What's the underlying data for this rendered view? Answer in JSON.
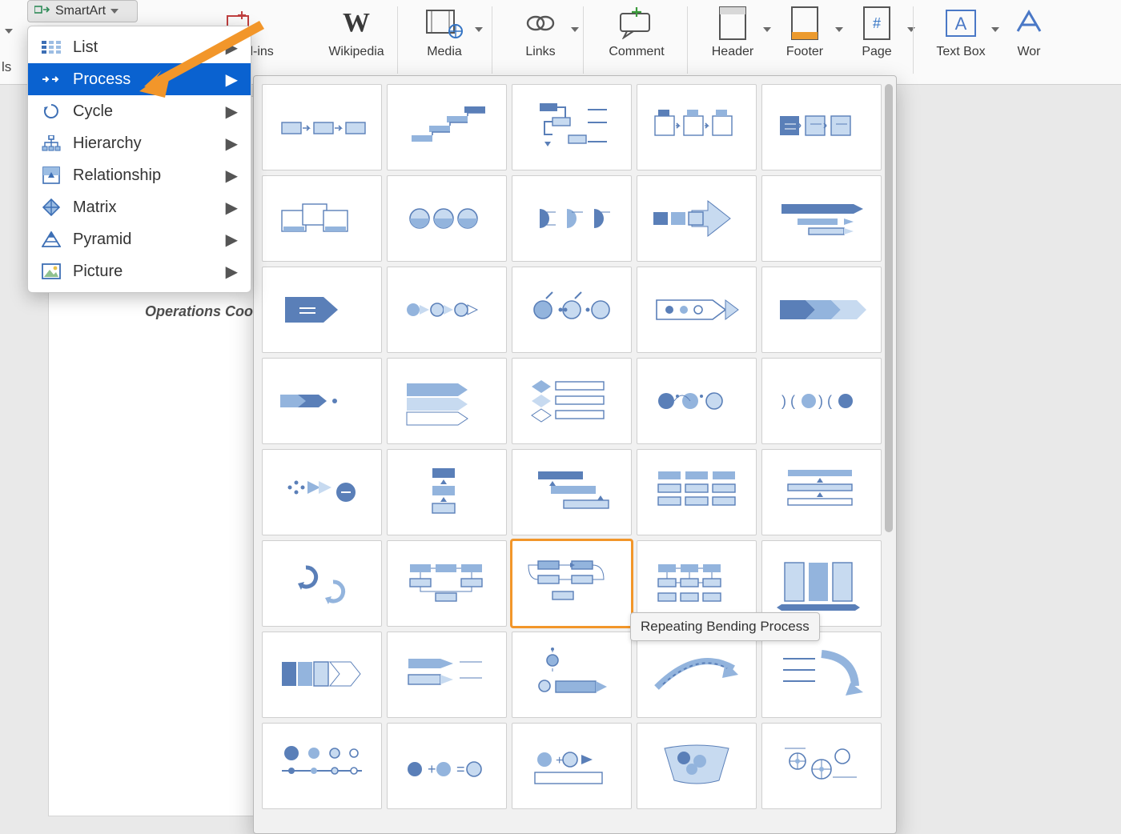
{
  "ribbon": {
    "smartart_label": "SmartArt",
    "addins_label": "Get Add-ins",
    "wikipedia_label": "Wikipedia",
    "media_label": "Media",
    "links_label": "Links",
    "comment_label": "Comment",
    "header_label": "Header",
    "footer_label": "Footer",
    "page_label": "Page",
    "textbox_label": "Text Box",
    "wordart_label": "Wor",
    "ls_label": "ls"
  },
  "menu": {
    "items": [
      {
        "label": "List",
        "icon": "list-icon"
      },
      {
        "label": "Process",
        "icon": "process-icon",
        "selected": true
      },
      {
        "label": "Cycle",
        "icon": "cycle-icon"
      },
      {
        "label": "Hierarchy",
        "icon": "hierarchy-icon"
      },
      {
        "label": "Relationship",
        "icon": "relationship-icon"
      },
      {
        "label": "Matrix",
        "icon": "matrix-icon"
      },
      {
        "label": "Pyramid",
        "icon": "pyramid-icon"
      },
      {
        "label": "Picture",
        "icon": "picture-icon"
      }
    ]
  },
  "gallery": {
    "tooltip": "Repeating Bending Process",
    "highlight_index": 27,
    "thumb_count": 40
  },
  "document": {
    "peek_text": "Operations Coord"
  },
  "colors": {
    "accent": "#0a62d0",
    "annotation": "#f2962a",
    "smartart_dark": "#3f68a8",
    "smartart_light": "#b9cfe9"
  }
}
